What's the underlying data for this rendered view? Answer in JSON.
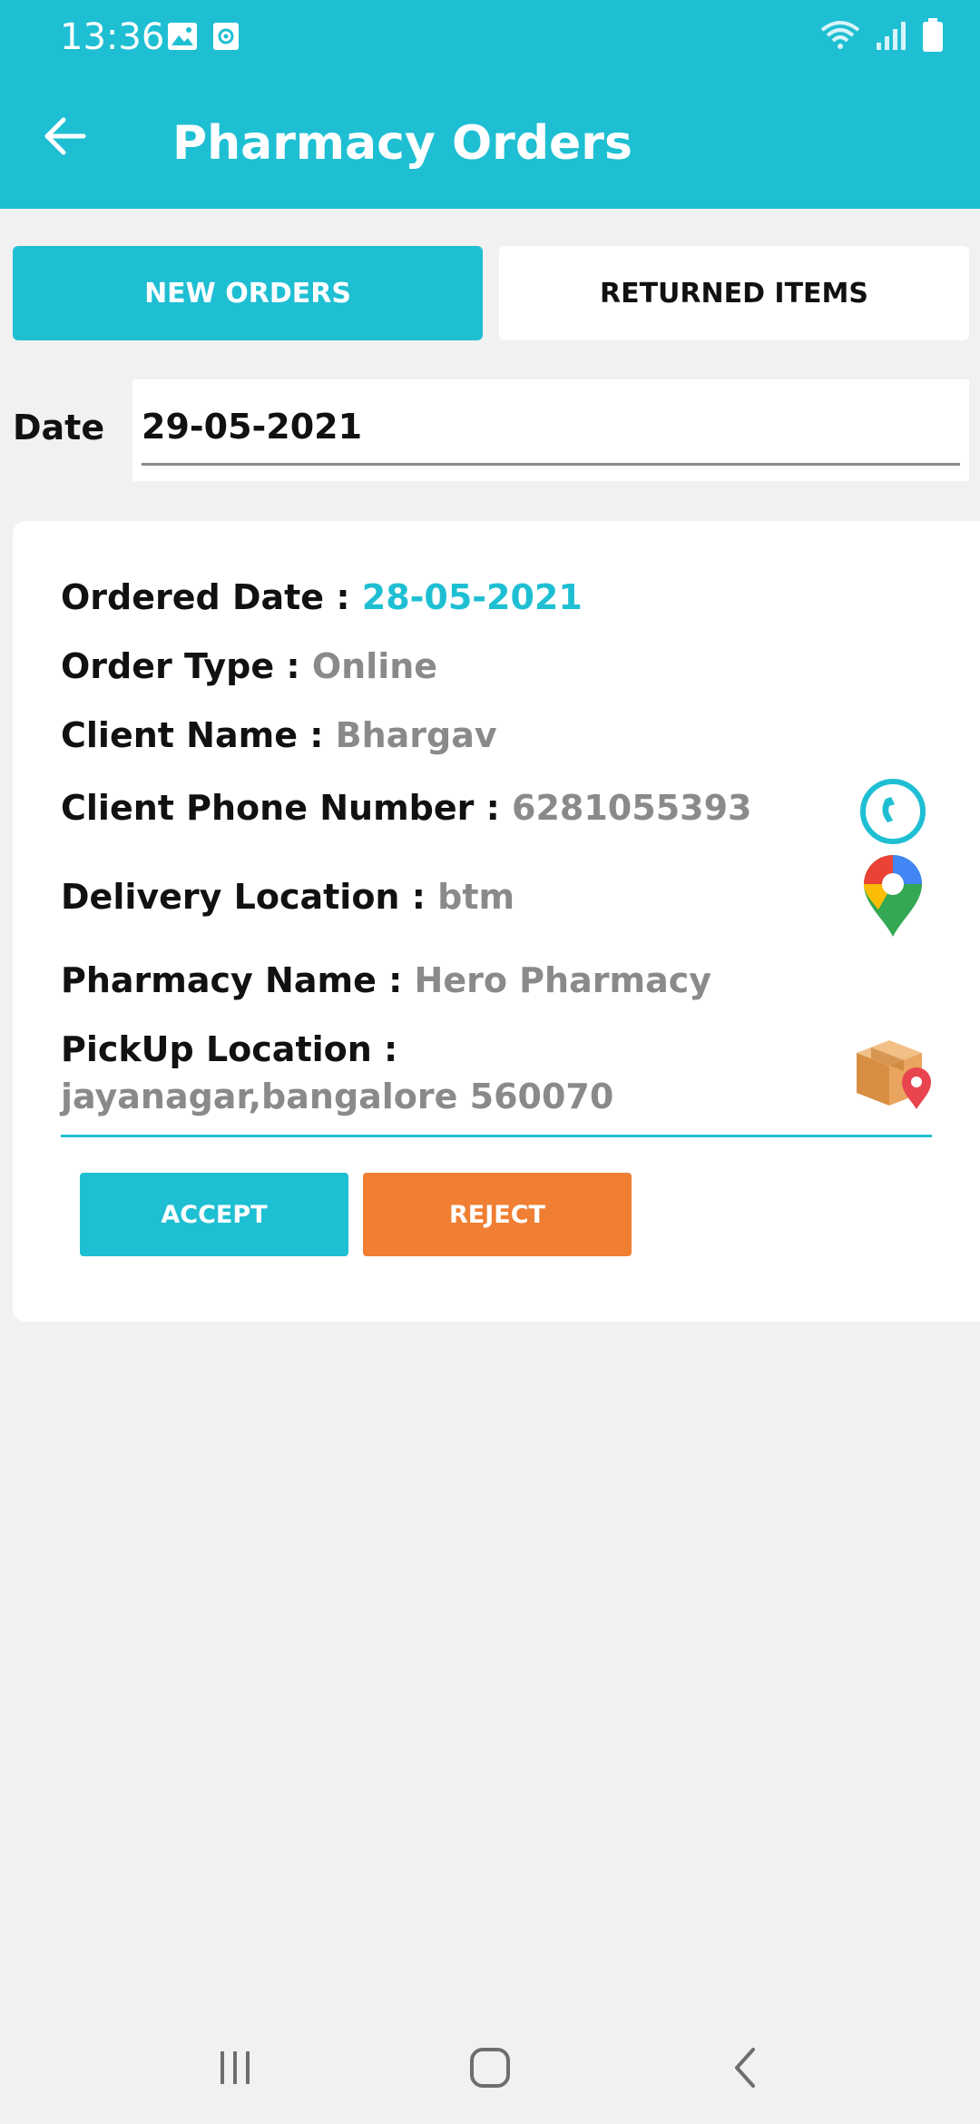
{
  "status_bar": {
    "time": "13:36",
    "left_icons": [
      "gallery-icon",
      "screen-record-icon"
    ],
    "right_icons": [
      "wifi-icon",
      "signal-icon",
      "battery-icon"
    ]
  },
  "app_bar": {
    "title": "Pharmacy Orders",
    "back_icon": "arrow-left-icon",
    "color": "#1fbfd3"
  },
  "tabs": [
    {
      "label": "NEW ORDERS",
      "selected": true
    },
    {
      "label": "RETURNED ITEMS",
      "selected": false
    }
  ],
  "date_filter": {
    "label": "Date",
    "value": "29-05-2021"
  },
  "order": {
    "ordered_date_label": "Ordered Date",
    "ordered_date_sep": " : ",
    "ordered_date": "28-05-2021",
    "order_type_label": "Order Type",
    "order_type_sep": " : ",
    "order_type": "Online",
    "client_name_label": "Client Name",
    "client_name_sep": " : ",
    "client_name": "Bhargav",
    "client_phone_label": "Client Phone Number",
    "client_phone_sep": " : ",
    "client_phone": "6281055393",
    "delivery_location_label": "Delivery Location",
    "delivery_location_sep": " : ",
    "delivery_location": "btm",
    "pharmacy_name_label": "Pharmacy Name",
    "pharmacy_name_sep": " : ",
    "pharmacy_name": "Hero Pharmacy",
    "pickup_location_label": "PickUp Location",
    "pickup_location_sep": " : ",
    "pickup_location": "jayanagar,bangalore 560070",
    "call_icon": "phone-call-icon",
    "map_icon": "map-pin-icon",
    "package_icon": "package-location-icon"
  },
  "actions": {
    "accept": "ACCEPT",
    "reject": "REJECT",
    "accept_color": "#1fbfd3",
    "reject_color": "#f07f33"
  },
  "nav_bar": {
    "icons": [
      "recent-apps-icon",
      "home-icon",
      "back-nav-icon"
    ]
  }
}
